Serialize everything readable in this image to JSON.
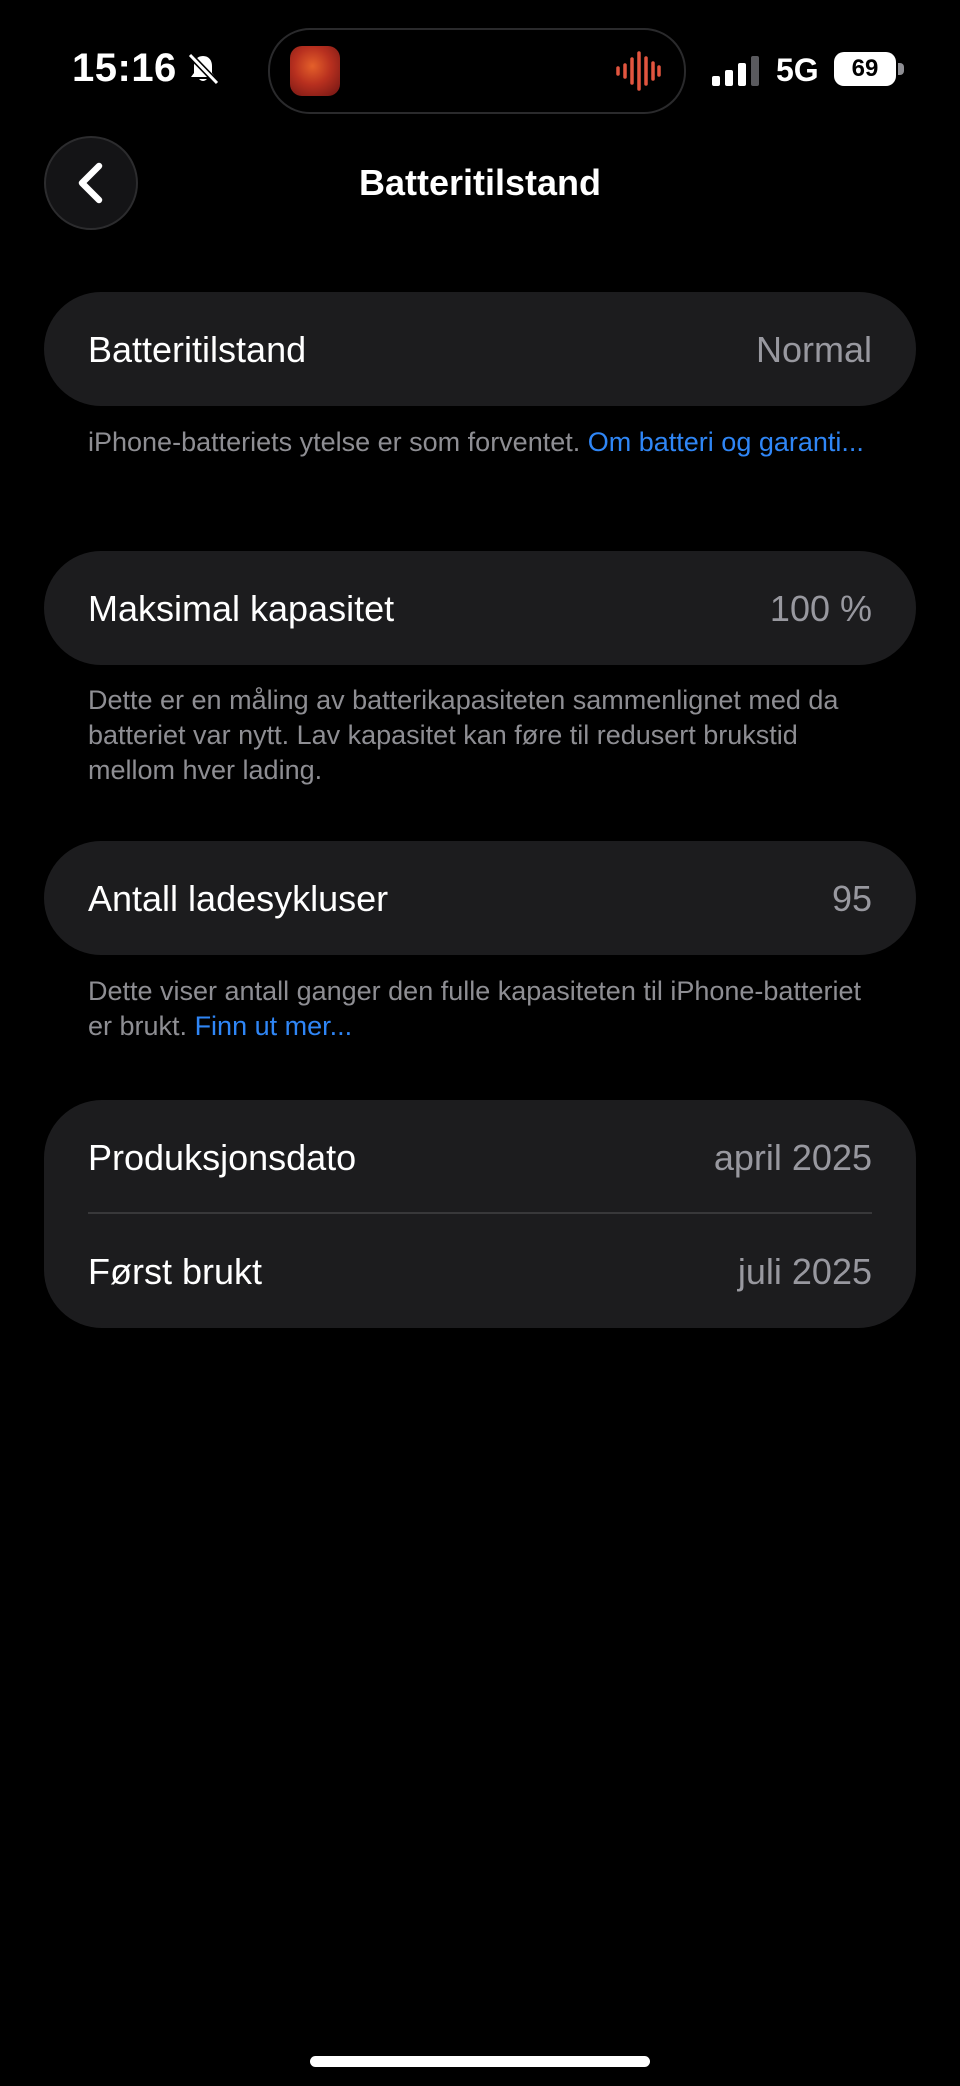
{
  "status_bar": {
    "time": "15:16",
    "network": "5G",
    "battery_level": "69",
    "icons": [
      "bell-slash-icon",
      "signal-bars-icon",
      "battery-icon",
      "audio-waveform-icon"
    ]
  },
  "nav": {
    "title": "Batteritilstand",
    "back_icon": "chevron-left-icon"
  },
  "sections": {
    "health": {
      "label": "Batteritilstand",
      "value": "Normal",
      "note_text": "iPhone-batteriets ytelse er som forventet.",
      "note_link": "Om batteri og garanti..."
    },
    "capacity": {
      "label": "Maksimal kapasitet",
      "value": "100 %",
      "note_text": "Dette er en måling av batterikapasiteten sammenlignet med da batteriet var nytt. Lav kapasitet kan føre til redusert brukstid mellom hver lading."
    },
    "cycles": {
      "label": "Antall ladesykluser",
      "value": "95",
      "note_text": "Dette viser antall ganger den fulle kapasiteten til iPhone-batteriet er brukt.",
      "note_link": "Finn ut mer..."
    },
    "dates": {
      "manufacture_label": "Produksjonsdato",
      "manufacture_value": "april 2025",
      "first_use_label": "Først brukt",
      "first_use_value": "juli 2025"
    }
  },
  "colors": {
    "background": "#000000",
    "card": "#1c1c1e",
    "link": "#2f86f6",
    "secondary_text": "#8e8e93",
    "waveform": "#e2553f"
  }
}
